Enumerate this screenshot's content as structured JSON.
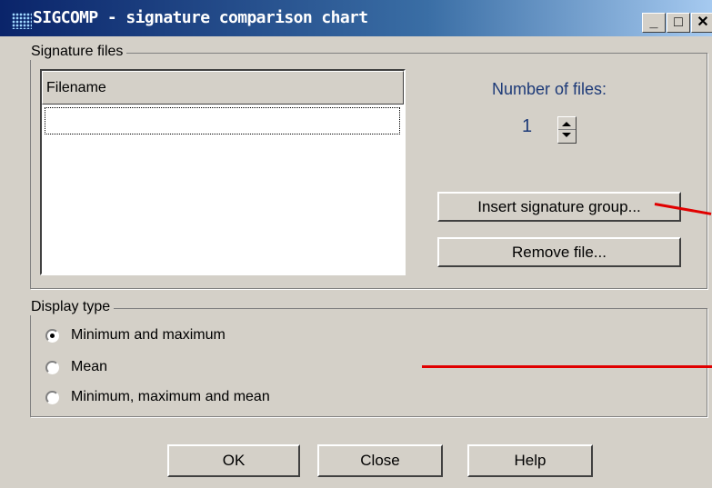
{
  "window": {
    "title": "SIGCOMP - signature comparison chart",
    "minimize_label": "_",
    "maximize_label": "□",
    "close_label": "✕"
  },
  "signature_files": {
    "legend": "Signature files",
    "column_header": "Filename",
    "rows": [
      ""
    ],
    "number_of_files_label": "Number of files:",
    "number_of_files_value": "1",
    "insert_button": "Insert signature group...",
    "remove_button": "Remove file..."
  },
  "display_type": {
    "legend": "Display type",
    "options": [
      {
        "label": "Minimum and maximum",
        "checked": true
      },
      {
        "label": "Mean",
        "checked": false
      },
      {
        "label": "Minimum, maximum and mean",
        "checked": false
      }
    ]
  },
  "buttons": {
    "ok": "OK",
    "close": "Close",
    "help": "Help"
  },
  "colors": {
    "annotation_arrow": "#e10000",
    "number_text": "#1d3a78"
  }
}
